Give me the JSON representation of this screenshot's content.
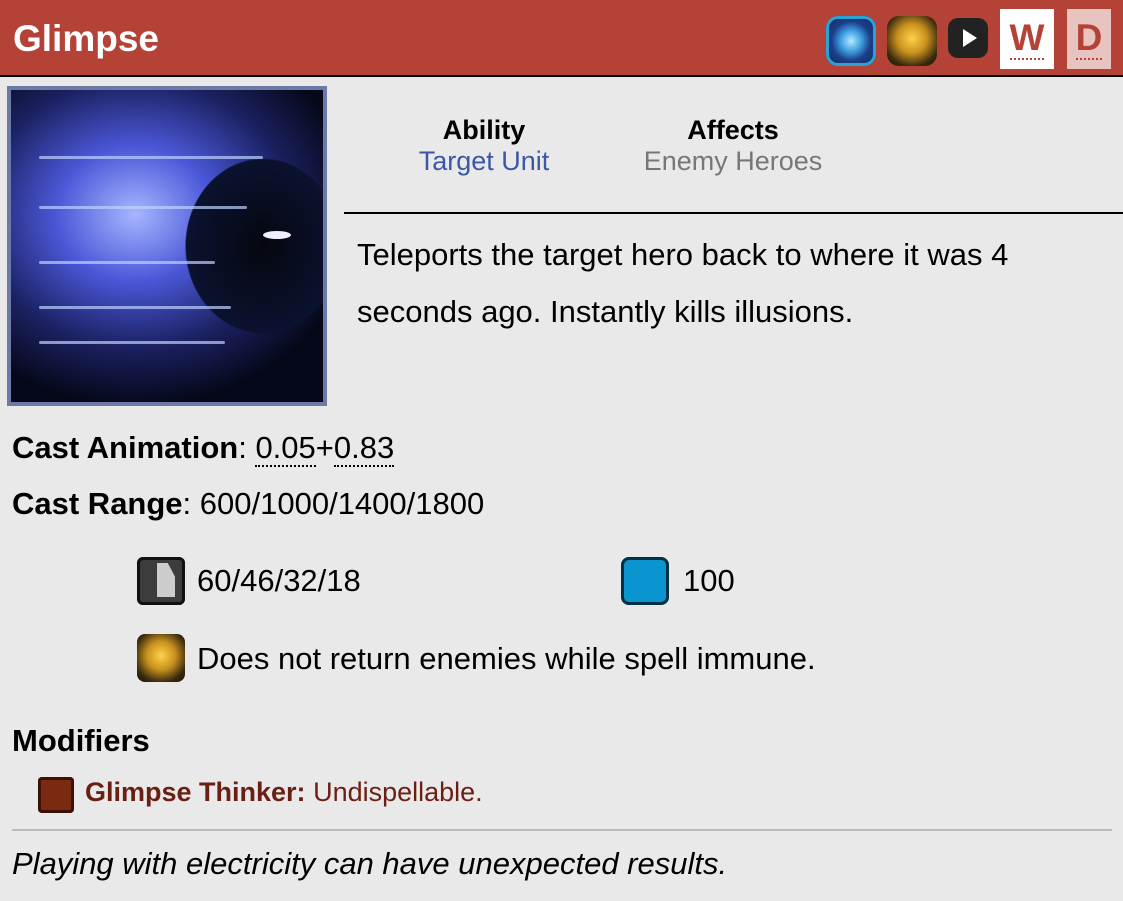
{
  "header": {
    "title": "Glimpse",
    "icons": [
      "aghanims-scepter-icon",
      "aghanims-shard-icon",
      "play-video-icon"
    ],
    "w_button": "W",
    "d_button": "D",
    "accent_color": "#b44237"
  },
  "ability": {
    "ability_label": "Ability",
    "ability_value": "Target Unit",
    "affects_label": "Affects",
    "affects_value": "Enemy Heroes",
    "description": "Teleports the target hero back to where it was 4 seconds ago. Instantly kills illusions."
  },
  "stats": {
    "cast_animation_label": "Cast Animation",
    "cast_animation_sep": ": ",
    "cast_point": "0.05",
    "plus": "+",
    "cast_backswing": "0.83",
    "cast_range_label": "Cast Range",
    "cast_range_sep": ": ",
    "cast_range_value": "600/1000/1400/1800",
    "cooldown": "60/46/32/18",
    "mana": "100",
    "shard_note": "Does not return enemies while spell immune."
  },
  "modifiers": {
    "heading": "Modifiers",
    "name": "Glimpse Thinker:",
    "property": " Undispellable."
  },
  "lore": "Playing with electricity can have unexpected results."
}
